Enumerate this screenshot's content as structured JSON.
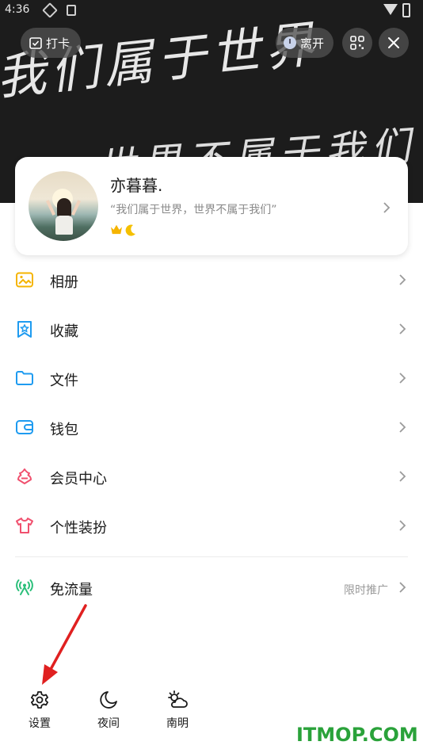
{
  "status_bar": {
    "time": "4:36"
  },
  "banner": {
    "handwriting_line1": "我们属于世界",
    "handwriting_line2": "世界不属于我们"
  },
  "top_actions": {
    "checkin_label": "打卡",
    "away_label": "离开",
    "qr_icon": "qr-code-icon",
    "close_icon": "close-icon"
  },
  "profile": {
    "nickname": "亦暮暮.",
    "signature": "“我们属于世界，世界不属于我们”",
    "badges": [
      "crown-icon",
      "moon-icon"
    ]
  },
  "menu": [
    {
      "label": "相册",
      "icon": "album-icon",
      "color": "#f5b400"
    },
    {
      "label": "收藏",
      "icon": "favorites-icon",
      "color": "#1e9bf0"
    },
    {
      "label": "文件",
      "icon": "folder-icon",
      "color": "#1e9bf0"
    },
    {
      "label": "钱包",
      "icon": "wallet-icon",
      "color": "#1e9bf0"
    },
    {
      "label": "会员中心",
      "icon": "member-icon",
      "color": "#f0506e"
    },
    {
      "label": "个性装扮",
      "icon": "tshirt-icon",
      "color": "#f0506e"
    }
  ],
  "promo_item": {
    "label": "免流量",
    "icon": "signal-tower-icon",
    "color": "#2bbf7a",
    "hint": "限时推广"
  },
  "bottom_tools": [
    {
      "label": "设置",
      "icon": "gear-icon"
    },
    {
      "label": "夜间",
      "icon": "moon-icon"
    },
    {
      "label": "南明",
      "icon": "weather-icon"
    }
  ],
  "watermark": "ITMOP.COM",
  "colors": {
    "annotation_arrow": "#e02020",
    "watermark": "#2aa23a"
  }
}
